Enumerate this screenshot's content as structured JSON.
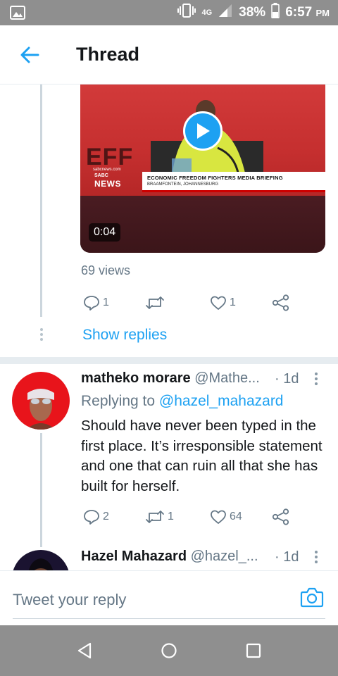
{
  "status_bar": {
    "network": "4G",
    "battery": "38%",
    "time": "6:57",
    "ampm": "PM"
  },
  "header": {
    "title": "Thread"
  },
  "video": {
    "duration": "0:04",
    "channel_url": "sabcnews.com",
    "channel_logo": "SABC",
    "channel_name": "NEWS",
    "headline": "ECONOMIC FREEDOM FIGHTERS MEDIA BRIEFING",
    "location": "BRAAMFONTEIN, JOHANNESBURG",
    "backdrop_text": "EFF"
  },
  "first_tweet": {
    "views": "69 views",
    "reply_count": "1",
    "retweet_count": "",
    "like_count": "1"
  },
  "show_replies": "Show replies",
  "tweets": [
    {
      "name": "matheko morare",
      "handle": "@Mathe...",
      "time": "· 1d",
      "replying_prefix": "Replying to",
      "replying_to": "@hazel_mahazard",
      "text": "Should have never been typed in the first place. It’s irresponsible statement and one that can ruin all that she has built for herself.",
      "reply_count": "2",
      "retweet_count": "1",
      "like_count": "64"
    },
    {
      "name": "Hazel Mahazard",
      "handle": "@hazel_...",
      "time": "· 1d"
    }
  ],
  "reply_bar": {
    "placeholder": "Tweet your reply"
  },
  "colors": {
    "accent": "#1da1f2",
    "system_bar": "#8f8f8f",
    "muted_text": "#657786"
  }
}
